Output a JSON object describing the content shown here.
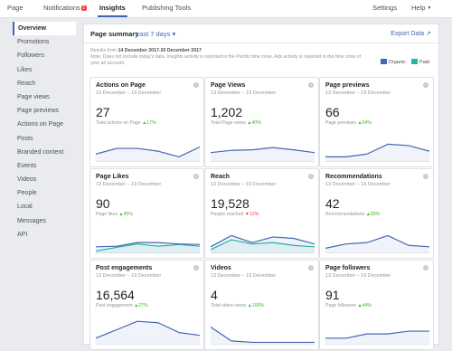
{
  "topbar": {
    "page": "Page",
    "notifications": "Notifications",
    "notifications_badge": "1",
    "insights": "Insights",
    "publishing": "Publishing Tools",
    "settings": "Settings",
    "help": "Help",
    "help_caret": "▼"
  },
  "sidebar": {
    "items": [
      {
        "label": "Overview"
      },
      {
        "label": "Promotions"
      },
      {
        "label": "Followers"
      },
      {
        "label": "Likes"
      },
      {
        "label": "Reach"
      },
      {
        "label": "Page views"
      },
      {
        "label": "Page previews"
      },
      {
        "label": "Actions on Page"
      },
      {
        "label": "Posts"
      },
      {
        "label": "Branded content"
      },
      {
        "label": "Events"
      },
      {
        "label": "Videos"
      },
      {
        "label": "People"
      },
      {
        "label": "Local"
      },
      {
        "label": "Messages"
      },
      {
        "label": "API"
      }
    ]
  },
  "summary": {
    "title": "Page summary",
    "range": "Last 7 days",
    "range_caret": "▾",
    "export": "Export Data",
    "export_icon": "↗",
    "results_prefix": "Results from ",
    "results_range": "14 December 2017-20 December 2017",
    "note": "Note: Does not include today's data. Insights activity is reported in the Pacific time zone. Ads activity is reported in the time zone of your ad account.",
    "legend_organic": "Organic",
    "legend_paid": "Paid"
  },
  "colors": {
    "organic": "#4267b2",
    "paid": "#20b8a4",
    "up": "#42b72a",
    "down": "#fa3e3e"
  },
  "cards": [
    {
      "title": "Actions on Page",
      "date": "13 December – 19 December",
      "value": "27",
      "sub": "Total actions on Page",
      "arrow": "▲",
      "change": "17%",
      "dir": "up",
      "organic": [
        0.25,
        0.45,
        0.45,
        0.35,
        0.15,
        0.5
      ],
      "paid": null
    },
    {
      "title": "Page Views",
      "date": "13 December – 19 December",
      "value": "1,202",
      "sub": "Total Page views",
      "arrow": "▲",
      "change": "40%",
      "dir": "up",
      "organic": [
        0.3,
        0.38,
        0.4,
        0.48,
        0.4,
        0.3
      ],
      "paid": null
    },
    {
      "title": "Page previews",
      "date": "13 December – 19 December",
      "value": "66",
      "sub": "Page previews",
      "arrow": "▲",
      "change": "54%",
      "dir": "up",
      "organic": [
        0.15,
        0.15,
        0.25,
        0.6,
        0.55,
        0.35
      ],
      "paid": null
    },
    {
      "title": "Page Likes",
      "date": "13 December – 19 December",
      "value": "90",
      "sub": "Page likes",
      "arrow": "▲",
      "change": "45%",
      "dir": "up",
      "organic": [
        0.2,
        0.22,
        0.35,
        0.35,
        0.3,
        0.28
      ],
      "paid": [
        0.05,
        0.18,
        0.3,
        0.22,
        0.28,
        0.22
      ]
    },
    {
      "title": "Reach",
      "date": "13 December – 19 December",
      "value": "19,528",
      "sub": "People reached",
      "arrow": "▼",
      "change": "12%",
      "dir": "down",
      "organic": [
        0.2,
        0.6,
        0.35,
        0.55,
        0.5,
        0.3
      ],
      "paid": [
        0.1,
        0.45,
        0.3,
        0.35,
        0.25,
        0.2
      ]
    },
    {
      "title": "Recommendations",
      "date": "13 December – 19 December",
      "value": "42",
      "sub": "Recommendations",
      "arrow": "▲",
      "change": "83%",
      "dir": "up",
      "organic": [
        0.15,
        0.3,
        0.35,
        0.6,
        0.25,
        0.2
      ],
      "paid": null
    },
    {
      "title": "Post engagements",
      "date": "13 December – 19 December",
      "value": "16,564",
      "sub": "Post engagement",
      "arrow": "▲",
      "change": "27%",
      "dir": "up",
      "organic": [
        0.2,
        0.5,
        0.8,
        0.75,
        0.4,
        0.3
      ],
      "paid": null
    },
    {
      "title": "Videos",
      "date": "13 December – 19 December",
      "value": "4",
      "sub": "Total video views",
      "arrow": "▲",
      "change": "100%",
      "dir": "up",
      "organic": [
        0.6,
        0.1,
        0.05,
        0.05,
        0.05,
        0.05
      ],
      "paid": null
    },
    {
      "title": "Page followers",
      "date": "13 December – 19 December",
      "value": "91",
      "sub": "Page followers",
      "arrow": "▲",
      "change": "44%",
      "dir": "up",
      "organic": [
        0.2,
        0.2,
        0.35,
        0.35,
        0.45,
        0.45
      ],
      "paid": null
    }
  ]
}
